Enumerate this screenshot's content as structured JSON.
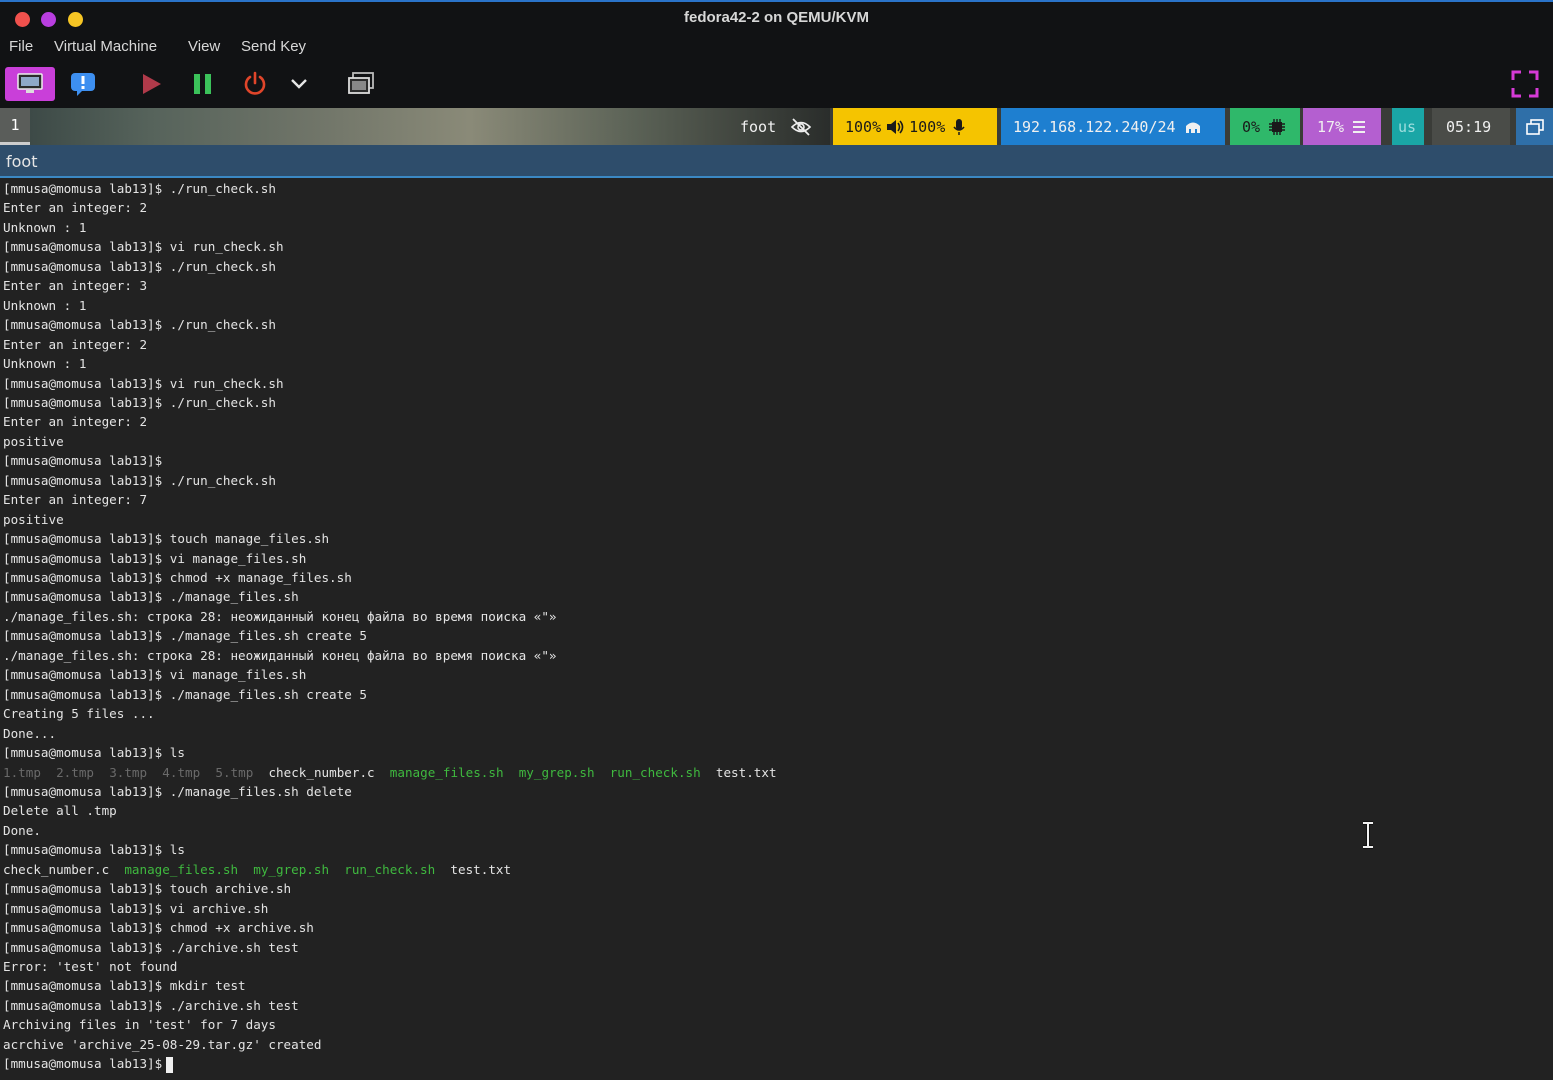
{
  "window": {
    "title": "fedora42-2 on QEMU/KVM"
  },
  "menu": [
    "File",
    "Virtual Machine",
    "View",
    "Send Key"
  ],
  "toolbar": {
    "icons": [
      "monitor-icon",
      "info-icon",
      "play-icon",
      "pause-icon",
      "power-icon",
      "chevron-down-icon",
      "screens-icon",
      "fullscreen-icon"
    ],
    "accent_color": "#c93fd9"
  },
  "statusbar": {
    "workspace": "1",
    "app": "foot",
    "volume": "100%",
    "mic": "100%",
    "ip": "192.168.122.240/24",
    "cpu": "0%",
    "mem": "17%",
    "layout": "us",
    "time": "05:19",
    "colors": {
      "audio": "#f5c400",
      "net": "#1e7fd0",
      "cpu": "#2fb86a",
      "mem": "#b45fd0",
      "kbd": "#1aa6a6"
    }
  },
  "terminal": {
    "title": "foot",
    "lines": [
      "[mmusa@momusa lab13]$ ./run_check.sh",
      "Enter an integer: 2",
      "Unknown : 1",
      "[mmusa@momusa lab13]$ vi run_check.sh",
      "[mmusa@momusa lab13]$ ./run_check.sh",
      "Enter an integer: 3",
      "Unknown : 1",
      "[mmusa@momusa lab13]$ ./run_check.sh",
      "Enter an integer: 2",
      "Unknown : 1",
      "[mmusa@momusa lab13]$ vi run_check.sh",
      "[mmusa@momusa lab13]$ ./run_check.sh",
      "Enter an integer: 2",
      "positive",
      "[mmusa@momusa lab13]$",
      "[mmusa@momusa lab13]$ ./run_check.sh",
      "Enter an integer: 7",
      "positive",
      "[mmusa@momusa lab13]$ touch manage_files.sh",
      "[mmusa@momusa lab13]$ vi manage_files.sh",
      "[mmusa@momusa lab13]$ chmod +x manage_files.sh",
      "[mmusa@momusa lab13]$ ./manage_files.sh",
      "./manage_files.sh: строка 28: неожиданный конец файла во время поиска «\"»",
      "[mmusa@momusa lab13]$ ./manage_files.sh create 5",
      "./manage_files.sh: строка 28: неожиданный конец файла во время поиска «\"»",
      "[mmusa@momusa lab13]$ vi manage_files.sh",
      "[mmusa@momusa lab13]$ ./manage_files.sh create 5",
      "Creating 5 files ...",
      "Done...",
      "[mmusa@momusa lab13]$ ls",
      "",
      "[mmusa@momusa lab13]$ ./manage_files.sh delete",
      "Delete all .tmp",
      "Done.",
      "[mmusa@momusa lab13]$ ls",
      "",
      "[mmusa@momusa lab13]$ touch archive.sh",
      "[mmusa@momusa lab13]$ vi archive.sh",
      "[mmusa@momusa lab13]$ chmod +x archive.sh",
      "[mmusa@momusa lab13]$ ./archive.sh test",
      "Error: 'test' not found",
      "[mmusa@momusa lab13]$ mkdir test",
      "[mmusa@momusa lab13]$ ./archive.sh test",
      "Archiving files in 'test' for 7 days",
      "acrchive 'archive_25-08-29.tar.gz' created",
      "[mmusa@momusa lab13]$"
    ],
    "ls1": [
      {
        "name": "1.tmp",
        "kind": "d"
      },
      {
        "name": "2.tmp",
        "kind": "d"
      },
      {
        "name": "3.tmp",
        "kind": "d"
      },
      {
        "name": "4.tmp",
        "kind": "d"
      },
      {
        "name": "5.tmp",
        "kind": "d"
      },
      {
        "name": "check_number.c",
        "kind": "w"
      },
      {
        "name": "manage_files.sh",
        "kind": "g"
      },
      {
        "name": "my_grep.sh",
        "kind": "g"
      },
      {
        "name": "run_check.sh",
        "kind": "g"
      },
      {
        "name": "test.txt",
        "kind": "w"
      }
    ],
    "ls2": [
      {
        "name": "check_number.c",
        "kind": "w"
      },
      {
        "name": "manage_files.sh",
        "kind": "g"
      },
      {
        "name": "my_grep.sh",
        "kind": "g"
      },
      {
        "name": "run_check.sh",
        "kind": "g"
      },
      {
        "name": "test.txt",
        "kind": "w"
      }
    ]
  }
}
